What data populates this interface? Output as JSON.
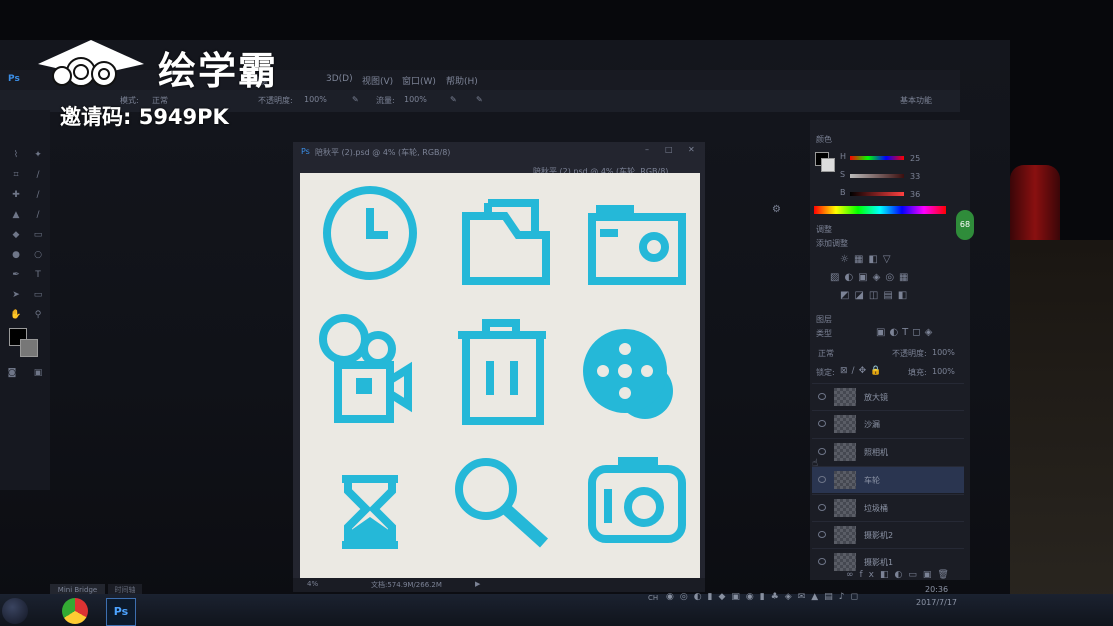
{
  "watermark": {
    "brand": "绘学霸",
    "invite_code": "邀请码: 5949PK"
  },
  "menubar": {
    "items": [
      "图像",
      "3D(D)",
      "视图(V)",
      "窗口(W)",
      "帮助(H)"
    ],
    "app_logo": "Ps"
  },
  "optionsbar": {
    "mode_label": "模式:",
    "mode_value": "正常",
    "opacity_label": "不透明度:",
    "opacity_value": "100%",
    "flow_label": "流量:",
    "flow_value": "100%",
    "workspace": "基本功能"
  },
  "document": {
    "title": "陪秋平 (2).psd @ 4% (车轮, RGB/8)",
    "tab_active": "陪秋平 (2).psd @ 4% (车轮, RGB/8)",
    "zoom": "4%",
    "doc_size": "文档:574.9M/266.2M",
    "icon_color": "#25b8d8"
  },
  "canvas_icons": [
    "clock-icon",
    "folder-icon",
    "camera-icon",
    "video-camera-icon",
    "trash-icon",
    "film-reel-icon",
    "hourglass-icon",
    "magnifier-icon",
    "photo-camera-icon"
  ],
  "panels": {
    "color_tab": "颜色",
    "color_values": [
      "25",
      "33",
      "36"
    ],
    "adjust_tab": "调整",
    "adjust_title": "添加调整",
    "layers_tab": "图层",
    "filter_kind": "类型",
    "blend_mode": "正常",
    "opacity_label": "不透明度:",
    "opacity_value": "100%",
    "lock_label": "锁定:",
    "fill_label": "填充:",
    "fill_value": "100%"
  },
  "layers": [
    {
      "name": "放大镜",
      "selected": false
    },
    {
      "name": "沙漏",
      "selected": false
    },
    {
      "name": "照相机",
      "selected": false
    },
    {
      "name": "车轮",
      "selected": true
    },
    {
      "name": "垃圾桶",
      "selected": false
    },
    {
      "name": "摄影机2",
      "selected": false
    },
    {
      "name": "摄影机1",
      "selected": false
    }
  ],
  "bottom_tabs": {
    "mini_bridge": "Mini Bridge",
    "timeline": "时间轴"
  },
  "taskbar": {
    "ps_label": "Ps",
    "lang": "CH",
    "time": "20:36",
    "date": "2017/7/17"
  }
}
